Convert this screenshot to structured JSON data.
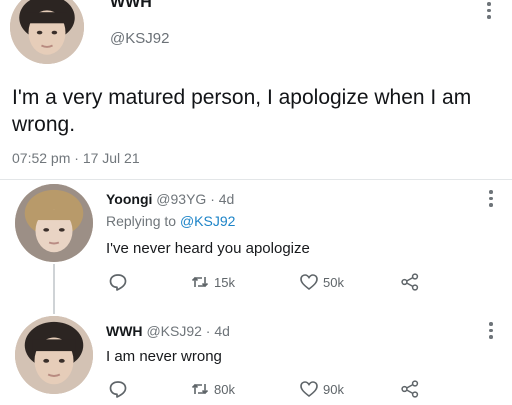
{
  "tweet": {
    "author_name": "WWH",
    "handle": "@KSJ92",
    "text": "I'm a very matured person, I apologize when I am wrong.",
    "timestamp": "07:52 pm · 17 Jul 21"
  },
  "replies": [
    {
      "name": "Yoongi",
      "handle": "@93YG",
      "age": "· 4d",
      "replying_prefix": "Replying to ",
      "replying_to": "@KSJ92",
      "text": "I've never heard you apologize",
      "retweets": "15k",
      "likes": "50k"
    },
    {
      "name": "WWH",
      "handle": "@KSJ92",
      "age": "· 4d",
      "text": "I am never wrong",
      "retweets": "80k",
      "likes": "90k"
    }
  ],
  "icons": {
    "more": "more-vertical-icon",
    "reply": "comment-icon",
    "retweet": "retweet-icon",
    "like": "heart-icon",
    "share": "share-icon"
  }
}
